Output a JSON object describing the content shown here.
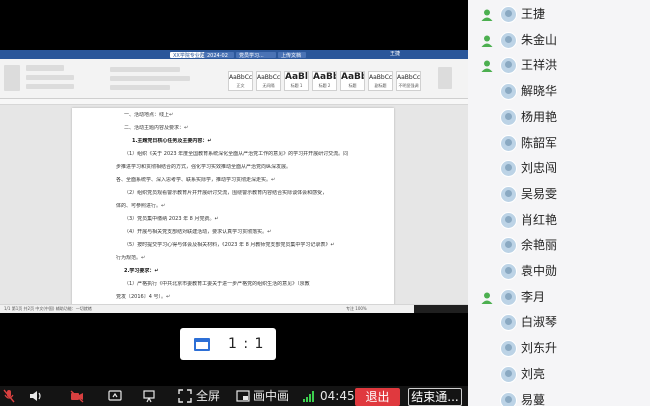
{
  "shared_doc": {
    "tabs": [
      "XX学院专业群...",
      "2024-02",
      "党员学习...",
      "上传文档"
    ],
    "title_right": "王捷",
    "style_gallery": [
      {
        "sample": "AaBbCcDd",
        "label": "正文",
        "heading": false
      },
      {
        "sample": "AaBbCcDd",
        "label": "无间隔",
        "heading": false
      },
      {
        "sample": "AaBl",
        "label": "标题 1",
        "heading": true
      },
      {
        "sample": "AaBbC",
        "label": "标题 2",
        "heading": true
      },
      {
        "sample": "AaBbC",
        "label": "标题",
        "heading": true
      },
      {
        "sample": "AaBbCcD",
        "label": "副标题",
        "heading": false
      },
      {
        "sample": "AaBbCcDd",
        "label": "不明显强调",
        "heading": false
      }
    ],
    "lines": [
      {
        "text": "一、活动地点：线上↵",
        "bold": false,
        "indent": 60
      },
      {
        "text": "二、活动主题内容及要求：↵",
        "bold": false,
        "indent": 60
      },
      {
        "text": "1.主题党日核心任务及主要内容：↵",
        "bold": true,
        "indent": 68
      },
      {
        "text": "（1）组织《关于 2023 年度全国教育系统深化全面从严治党工作的意见》的学习并开展研讨交流。同",
        "bold": false,
        "indent": 60
      },
      {
        "text": "步推进学习和贯彻相结合的方式，强化学习实效推动全面从严治党向纵深发展。",
        "bold": false,
        "indent": 52
      },
      {
        "text": "各、全面系统学、深入思考学、联系实际学，推动学习贯彻走深走实。↵",
        "bold": false,
        "indent": 52
      },
      {
        "text": "（2）组织党员观看警示教育片并开展研讨交流，围绕警示教育内容结合实际谈体会和感受，",
        "bold": false,
        "indent": 60
      },
      {
        "text": "体的、可参照进行。↵",
        "bold": false,
        "indent": 52
      },
      {
        "text": "（3）党员集中缴纳 2023 年 8 月党费。↵",
        "bold": false,
        "indent": 60
      },
      {
        "text": "（4）开展与相关党支部结对联建活动，要求认真学习贯彻落实。↵",
        "bold": false,
        "indent": 60
      },
      {
        "text": "（5）按时提交学习心得与体会及相关材料，《2023 年 8 月教师党支部党员集中学习记录表》↵",
        "bold": false,
        "indent": 60
      },
      {
        "text": "行为规范。↵",
        "bold": false,
        "indent": 52
      },
      {
        "text": "2.学习要求：↵",
        "bold": true,
        "indent": 60
      },
      {
        "text": "（1）严格执行《中共北京市委教育工委关于进一步严格党的组织生活的意见》（京教",
        "bold": false,
        "indent": 60
      },
      {
        "text": "党发〔2016〕4 号）。↵",
        "bold": false,
        "indent": 52
      }
    ],
    "status_left": "1/1  第1页 共2页  中文(中国)  辅助功能：一切就绪",
    "status_right": "专注  100%"
  },
  "ratio_popup": {
    "label": "1 : 1"
  },
  "toolbar": {
    "fullscreen": "全屏",
    "pip": "画中画",
    "time": "04:45",
    "exit": "退出",
    "end": "结束通..."
  },
  "participants": [
    {
      "name": "王捷",
      "host": true
    },
    {
      "name": "朱金山",
      "host": true
    },
    {
      "name": "王祥洪",
      "host": true
    },
    {
      "name": "解晓华",
      "host": false
    },
    {
      "name": "杨用艳",
      "host": false
    },
    {
      "name": "陈韶军",
      "host": false
    },
    {
      "name": "刘忠闯",
      "host": false
    },
    {
      "name": "吴易雯",
      "host": false
    },
    {
      "name": "肖红艳",
      "host": false
    },
    {
      "name": "余艳丽",
      "host": false
    },
    {
      "name": "袁中勋",
      "host": false
    },
    {
      "name": "李月",
      "host": true
    },
    {
      "name": "白淑琴",
      "host": false
    },
    {
      "name": "刘东升",
      "host": false
    },
    {
      "name": "刘亮",
      "host": false
    },
    {
      "name": "易蔓",
      "host": false
    }
  ],
  "colors": {
    "accent": "#2d6fd6",
    "exit": "#e0393e",
    "word_blue": "#2b579a",
    "host_green": "#4caf50"
  }
}
